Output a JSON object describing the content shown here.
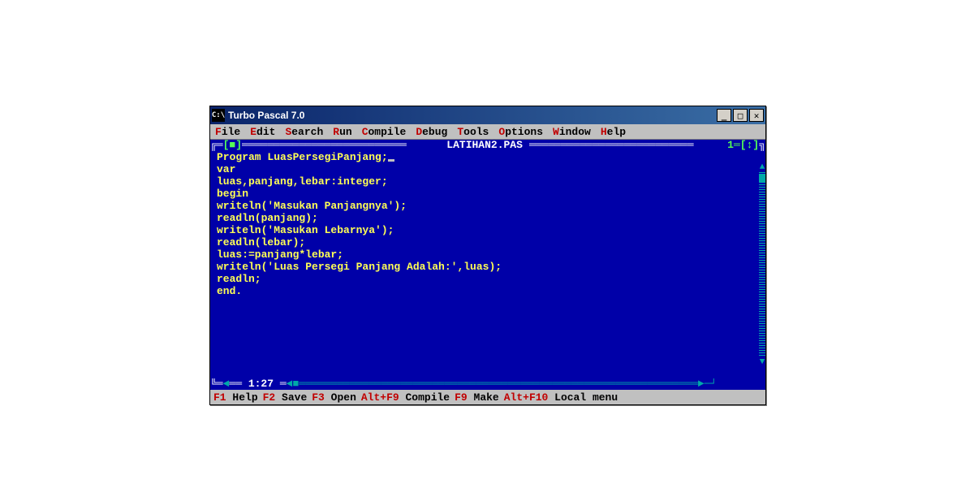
{
  "window": {
    "title": "Turbo Pascal 7.0"
  },
  "menu": {
    "file": {
      "hot": "F",
      "rest": "ile"
    },
    "edit": {
      "hot": "E",
      "rest": "dit"
    },
    "search": {
      "hot": "S",
      "rest": "earch"
    },
    "run": {
      "hot": "R",
      "rest": "un"
    },
    "compile": {
      "hot": "C",
      "rest": "ompile"
    },
    "debug": {
      "hot": "D",
      "rest": "ebug"
    },
    "tools": {
      "hot": "T",
      "rest": "ools"
    },
    "options": {
      "hot": "O",
      "rest": "ptions"
    },
    "window": {
      "hot": "W",
      "rest": "indow"
    },
    "help": {
      "hot": "H",
      "rest": "elp"
    }
  },
  "editor": {
    "close_box": "[■]",
    "filename": " LATIHAN2.PAS ",
    "window_num": "1═[↕]",
    "cursor_pos": " 1:27 ",
    "code": [
      "Program LuasPersegiPanjang;",
      "var",
      "luas,panjang,lebar:integer;",
      "begin",
      "writeln('Masukan Panjangnya');",
      "readln(panjang);",
      "writeln('Masukan Lebarnya');",
      "readln(lebar);",
      "luas:=panjang*lebar;",
      "writeln('Luas Persegi Panjang Adalah:',luas);",
      "readln;",
      "end."
    ]
  },
  "status": {
    "f1": {
      "key": "F1",
      "lbl": " Help"
    },
    "f2": {
      "key": "F2",
      "lbl": " Save"
    },
    "f3": {
      "key": "F3",
      "lbl": " Open"
    },
    "af9": {
      "key": "Alt+F9",
      "lbl": " Compile"
    },
    "f9": {
      "key": "F9",
      "lbl": " Make"
    },
    "af10": {
      "key": "Alt+F10",
      "lbl": " Local menu"
    }
  }
}
